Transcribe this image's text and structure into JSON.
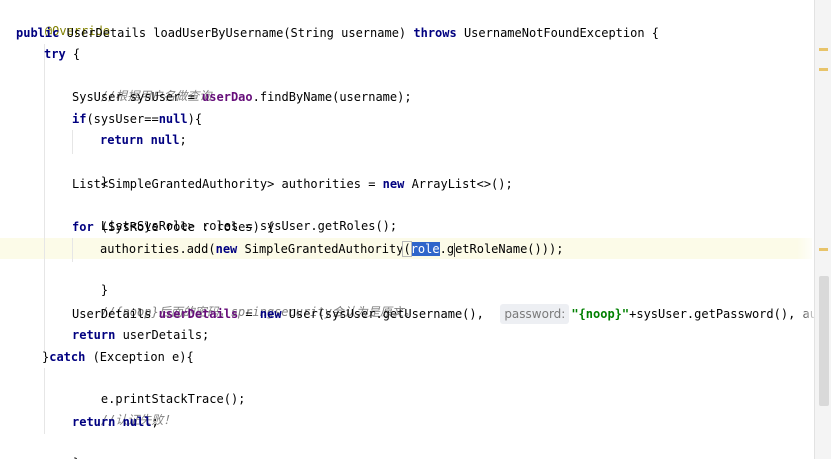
{
  "editor": {
    "line1": {
      "annotation": "@Override"
    },
    "line2": {
      "kw_public": "public",
      "rest1": " UserDetails loadUserByUsername(String username) ",
      "kw_throws": "throws",
      "rest2": " UsernameNotFoundException {"
    },
    "line3": {
      "kw_try": "try",
      "rest": " {"
    },
    "line4": {
      "comment": "//根据用户名做查询"
    },
    "line5": {
      "pre": "SysUser sysUser = ",
      "field": "userDao",
      "post": ".findByName(username);"
    },
    "line6": {
      "kw_if": "if",
      "pre": "(sysUser==",
      "kw_null": "null",
      "post": "){"
    },
    "line7": {
      "kw_return": "return",
      "space": " ",
      "kw_null": "null",
      "post": ";"
    },
    "line8": {
      "text": "}"
    },
    "line9": {
      "pre": "List<SimpleGrantedAuthority> authorities = ",
      "kw_new": "new",
      "post": " ArrayList<>();"
    },
    "line10": {
      "text": "List<SysRole> roles = sysUser.getRoles();"
    },
    "line11": {
      "kw_for": "for",
      "post": " (SysRole role : roles) {"
    },
    "line12": {
      "pre": "authorities.add(",
      "kw_new": "new",
      "mid": " SimpleGrantedAuthority",
      "paren": "(",
      "selected": "role",
      "dot": ".",
      "g": "g",
      "post": "etRoleName()));"
    },
    "line13": {
      "text": "}"
    },
    "line14": {
      "comment": "//{noop}后面的密码，springsecurity会认为是原文。"
    },
    "line15": {
      "pre": "UserDetails ",
      "field": "userDetails",
      "mid": " = ",
      "kw_new": "new",
      "call": " User(sysUser.getUsername(),  ",
      "hint_label": "password:",
      "str": "\"{noop}\"",
      "post": "+sysUser.getPassword(), authoriti"
    },
    "line16": {
      "kw_return": "return",
      "post": " userDetails;"
    },
    "line17": {
      "brace": "}",
      "kw_catch": "catch",
      "post": " (Exception e){"
    },
    "line18": {
      "text": "e.printStackTrace();"
    },
    "line19": {
      "comment": "//认证失败！"
    },
    "line20": {
      "kw_return": "return",
      "space": " ",
      "kw_null": "null",
      "post": ";"
    },
    "line21": {
      "text": "}"
    }
  },
  "colors": {
    "keyword": "#000080",
    "annotation": "#808000",
    "comment": "#808080",
    "field": "#660e7a",
    "string": "#008000",
    "selection": "#2f65ca",
    "current_line": "#fcfbe8"
  }
}
